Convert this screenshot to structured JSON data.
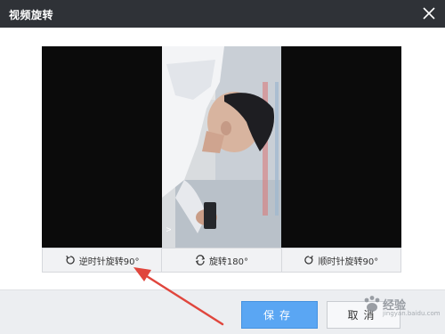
{
  "dialog": {
    "title": "视频旋转",
    "close_icon": "close-icon"
  },
  "rotate_controls": [
    {
      "label": "逆时针旋转90°",
      "icon": "rotate-ccw-icon"
    },
    {
      "label": "旋转180°",
      "icon": "rotate-180-icon"
    },
    {
      "label": "顺时针旋转90°",
      "icon": "rotate-cw-icon"
    }
  ],
  "footer": {
    "save_label": "保存",
    "cancel_label": "取消"
  },
  "watermark": {
    "text": "经验",
    "subtext": "jingyan.baidu.com"
  },
  "colors": {
    "titlebar": "#2f3237",
    "save_button": "#5aa6f3",
    "annotation_arrow": "#e0463d"
  }
}
